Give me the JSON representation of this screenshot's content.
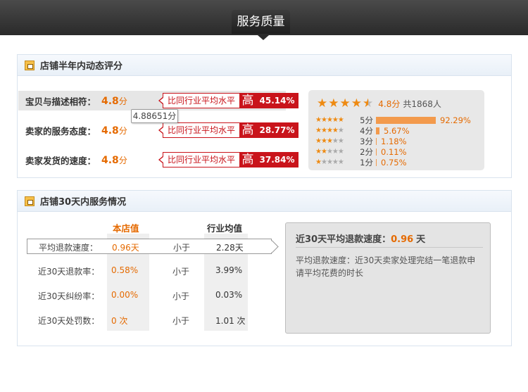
{
  "header": {
    "title": "服务质量"
  },
  "rating_panel": {
    "title": "店铺半年内动态评分",
    "rows": [
      {
        "label": "宝贝与描述相符：",
        "score": "4.8",
        "unit": "分",
        "compare_text": "比同行业平均水平",
        "level": "高",
        "percent": "45.14%"
      },
      {
        "label": "卖家的服务态度：",
        "score": "4.8",
        "unit": "分",
        "compare_text": "比同行业平均水平",
        "level": "高",
        "percent": "28.77%"
      },
      {
        "label": "卖家发货的速度：",
        "score": "4.8",
        "unit": "分",
        "compare_text": "比同行业平均水平",
        "level": "高",
        "percent": "37.84%"
      }
    ],
    "tooltip": "4.88651分",
    "distribution": {
      "score": "4.8分",
      "people": "共1868人",
      "rows": [
        {
          "stars": 5,
          "label": "5分",
          "percent": "92.29%",
          "fraction": 0.9229
        },
        {
          "stars": 4,
          "label": "4分",
          "percent": "5.67%",
          "fraction": 0.0567
        },
        {
          "stars": 3,
          "label": "3分",
          "percent": "1.18%",
          "fraction": 0.0118
        },
        {
          "stars": 2,
          "label": "2分",
          "percent": "0.11%",
          "fraction": 0.0011
        },
        {
          "stars": 1,
          "label": "1分",
          "percent": "0.75%",
          "fraction": 0.0075
        }
      ]
    }
  },
  "service_panel": {
    "title": "店铺30天内服务情况",
    "col_store": "本店值",
    "col_industry": "行业均值",
    "rows": [
      {
        "label": "平均退款速度：",
        "value": "0.96天",
        "compare": "小于",
        "industry": "2.28天"
      },
      {
        "label": "近30天退款率：",
        "value": "0.58%",
        "compare": "小于",
        "industry": "3.99%"
      },
      {
        "label": "近30天纠纷率：",
        "value": "0.00%",
        "compare": "小于",
        "industry": "0.03%"
      },
      {
        "label": "近30天处罚数：",
        "value": "0 次",
        "compare": "小于",
        "industry": "1.01 次"
      }
    ],
    "detail": {
      "title": "近30天平均退款速度：",
      "value": "0.96",
      "unit": "天",
      "text": "平均退款速度：近30天卖家处理完结一笔退款申请平均花费的时长"
    }
  },
  "colors": {
    "accent": "#e56a00",
    "high": "#c9141b",
    "bar": "#f39a4c"
  }
}
